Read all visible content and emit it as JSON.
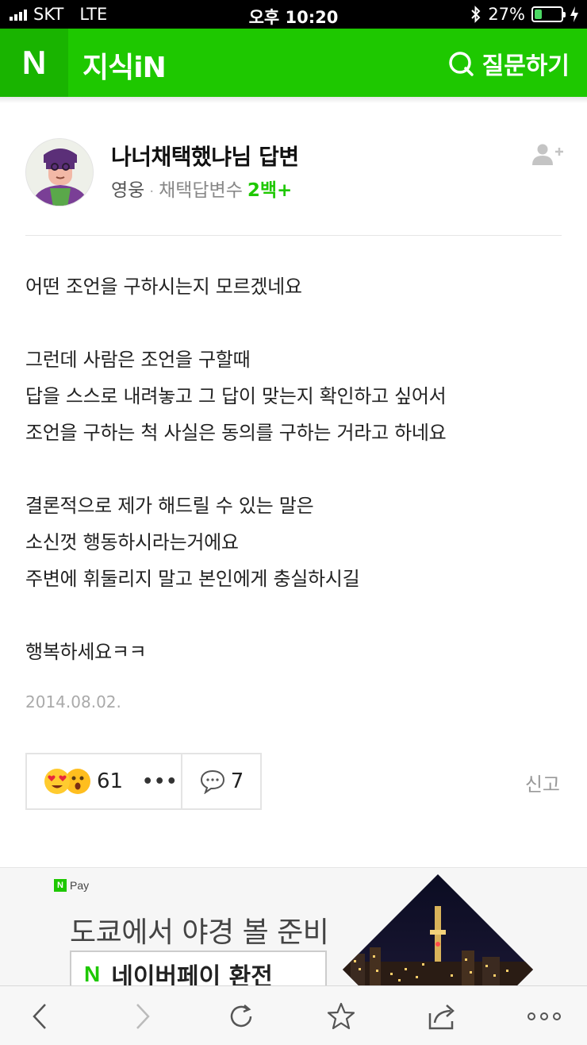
{
  "status_bar": {
    "carrier": "SKT",
    "network": "LTE",
    "time": "오후 10:20",
    "battery_percent": "27%",
    "battery_level": 0.27
  },
  "header": {
    "logo": "N",
    "brand": "지식iN",
    "ask_label": "질문하기"
  },
  "answer": {
    "title": "나너채택했냐님 답변",
    "rank": "영웅",
    "separator": "·",
    "selected_label": "채택답변수",
    "selected_count": "2백+",
    "body": [
      "어떤 조언을 구하시는지 모르겠네요",
      "",
      "그런데 사람은 조언을 구할때",
      "답을 스스로 내려놓고 그 답이 맞는지 확인하고 싶어서",
      "조언을 구하는 척 사실은 동의를 구하는 거라고 하네요",
      "",
      "결론적으로 제가 해드릴 수 있는 말은",
      "소신껏 행동하시라는거에요",
      "주변에 휘둘리지 말고 본인에게 충실하시길",
      "",
      "행복하세요ㅋㅋ"
    ],
    "date": "2014.08.02.",
    "reaction_count": "61",
    "more": "•••",
    "comment_count": "7",
    "report_label": "신고"
  },
  "ad": {
    "badge_n": "N",
    "badge_pay": "Pay",
    "headline": "도쿄에서 야경 볼 준비",
    "button_n": "N",
    "button_label": "네이버페이 환전"
  },
  "colors": {
    "brand_green": "#1ec800",
    "brand_green_dark": "#19b400"
  },
  "toolbar": [
    "back-icon",
    "forward-icon",
    "refresh-icon",
    "bookmark-star-icon",
    "share-icon",
    "more-icon"
  ]
}
